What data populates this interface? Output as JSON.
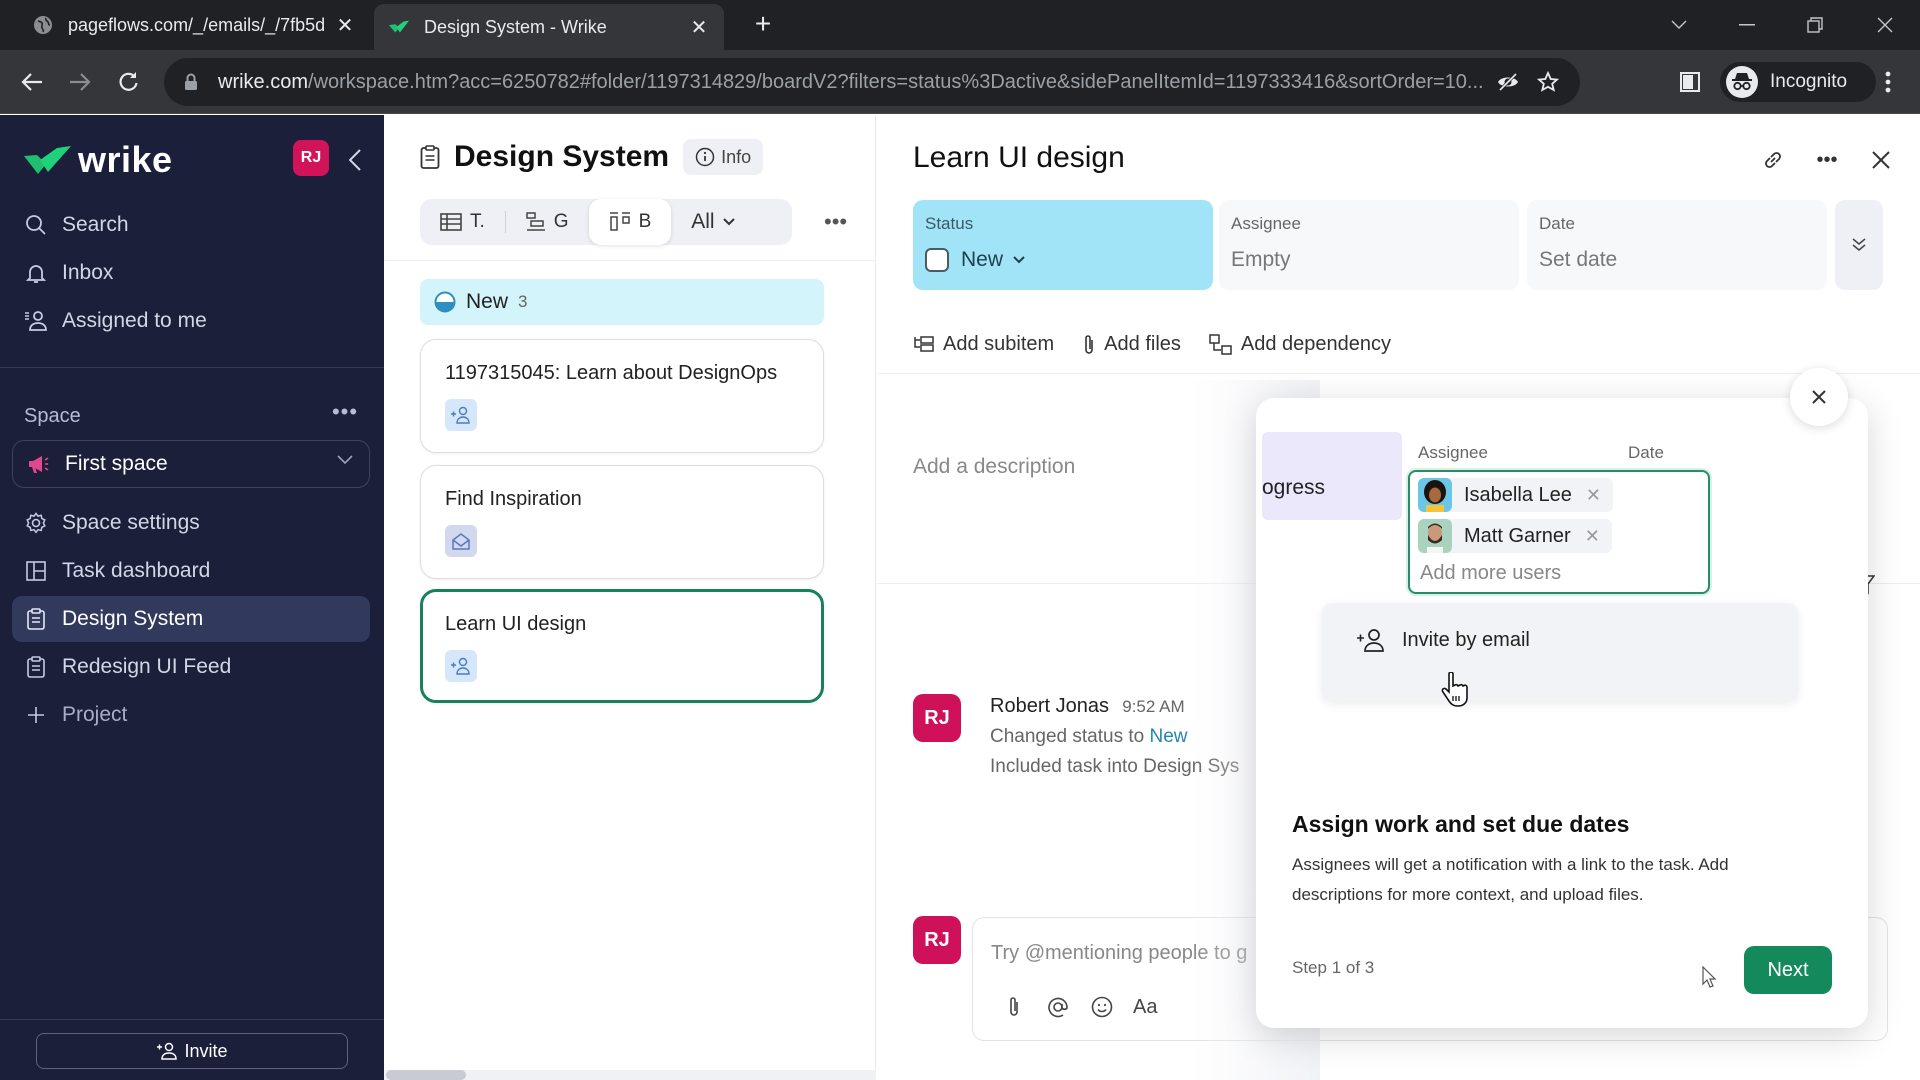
{
  "browser": {
    "tabs": [
      {
        "title": "pageflows.com/_/emails/_/7fb5d",
        "active": false,
        "icon": "globe-icon"
      },
      {
        "title": "Design System - Wrike",
        "active": true,
        "icon": "wrike-check-icon"
      }
    ],
    "url_host": "wrike.com",
    "url_path": "/workspace.htm?acc=6250782#folder/1197314829/boardV2?filters=status%3Dactive&sidePanelItemId=1197333416&sortOrder=10...",
    "profile_label": "Incognito"
  },
  "sidebar": {
    "logo_text": "wrike",
    "user_initials": "RJ",
    "nav": [
      {
        "label": "Search",
        "icon": "search-icon"
      },
      {
        "label": "Inbox",
        "icon": "bell-icon"
      },
      {
        "label": "Assigned to me",
        "icon": "assigned-user-icon"
      }
    ],
    "space_section_label": "Space",
    "space_selected": "First space",
    "space_items": [
      {
        "label": "Space settings",
        "icon": "gear-icon",
        "selected": false
      },
      {
        "label": "Task dashboard",
        "icon": "dashboard-icon",
        "selected": false
      },
      {
        "label": "Design System",
        "icon": "clipboard-icon",
        "selected": true
      },
      {
        "label": "Redesign UI Feed",
        "icon": "clipboard-icon",
        "selected": false
      },
      {
        "label": "Project",
        "icon": "plus-icon",
        "selected": false
      }
    ],
    "invite_label": "Invite"
  },
  "board": {
    "title": "Design System",
    "info_label": "Info",
    "views": [
      {
        "label": "T.",
        "icon": "table-icon",
        "active": false
      },
      {
        "label": "G",
        "icon": "gantt-icon",
        "active": false
      },
      {
        "label": "B",
        "icon": "board-icon",
        "active": true
      }
    ],
    "filter_label": "All",
    "group": {
      "name": "New",
      "count": "3"
    },
    "cards": [
      {
        "title": "1197315045: Learn about DesignOps",
        "badge": "add-assignee-icon",
        "selected": false
      },
      {
        "title": "Find Inspiration",
        "badge": "mail-icon",
        "selected": false
      },
      {
        "title": "Learn UI design",
        "badge": "add-assignee-icon",
        "selected": true
      }
    ]
  },
  "task": {
    "title": "Learn UI design",
    "fields": {
      "status": {
        "label": "Status",
        "value": "New"
      },
      "assignee": {
        "label": "Assignee",
        "value": "Empty"
      },
      "date": {
        "label": "Date",
        "value": "Set date"
      }
    },
    "toolbar": [
      "Add subitem",
      "Add files",
      "Add dependency"
    ],
    "description_placeholder": "Add a description",
    "activity": {
      "author_initials": "RJ",
      "author": "Robert Jonas",
      "time": "9:52 AM",
      "line1_prefix": "Changed status to ",
      "line1_status": "New",
      "line2": "Included task into Design Sys"
    },
    "comment": {
      "author_initials": "RJ",
      "placeholder": "Try @mentioning people to g",
      "tools": [
        "attach-icon",
        "mention-icon",
        "emoji-icon",
        "text-format-icon"
      ],
      "format_label": "Aa"
    }
  },
  "tour": {
    "mini_status_text": "ogress",
    "assignee_label": "Assignee",
    "date_label": "Date",
    "assignees": [
      "Isabella Lee",
      "Matt Garner"
    ],
    "add_more_placeholder": "Add more users",
    "invite_option": "Invite by email",
    "heading": "Assign work and set due dates",
    "body": "Assignees will get a notification with a link to the task. Add descriptions for more context, and upload files.",
    "step": "Step 1 of 3",
    "next_label": "Next"
  },
  "colors": {
    "sidebar_bg": "#1b1f3a",
    "brand_green": "#1fd17b",
    "accent_green": "#148a5c",
    "status_new": "#a1e3f7",
    "avatar_pink": "#d1145a",
    "link_blue": "#2486b8"
  }
}
